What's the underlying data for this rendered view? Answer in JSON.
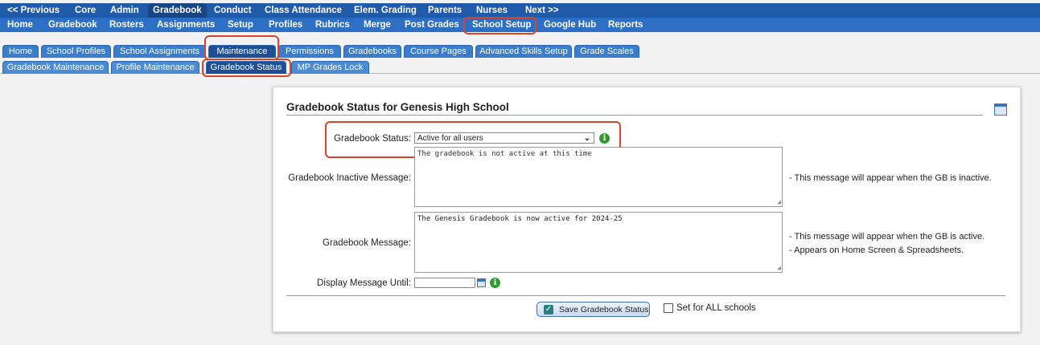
{
  "nav_top": [
    "<< Previous",
    "Core",
    "Admin",
    "Gradebook",
    "Conduct",
    "Class Attendance",
    "Elem. Grading",
    "Parents",
    "Nurses",
    "Next >>"
  ],
  "nav_sub": [
    "Home",
    "Gradebook",
    "Rosters",
    "Assignments",
    "Setup",
    "Profiles",
    "Rubrics",
    "Merge",
    "Post Grades",
    "School Setup",
    "Google Hub",
    "Reports"
  ],
  "tabs1": [
    "Home",
    "School Profiles",
    "School Assignments",
    "Maintenance",
    "Permissions",
    "Gradebooks",
    "Course Pages",
    "Advanced Skills Setup",
    "Grade Scales"
  ],
  "tabs2": [
    "Gradebook Maintenance",
    "Profile Maintenance",
    "Gradebook Status",
    "MP Grades Lock"
  ],
  "panel": {
    "title": "Gradebook Status for Genesis High School",
    "status_label": "Gradebook Status:",
    "status_value": "Active for all users",
    "inactive_label": "Gradebook Inactive Message:",
    "inactive_text": "The gradebook is not active at this time",
    "inactive_note": "- This message will appear when the GB is inactive.",
    "message_label": "Gradebook Message:",
    "message_text": "The Genesis Gradebook is now active for 2024-25",
    "message_note1": "- This message will appear when the GB is active.",
    "message_note2": "- Appears on Home Screen & Spreadsheets.",
    "display_label": "Display Message Until:",
    "save_label": "Save Gradebook Status",
    "all_schools_label": "Set for ALL schools"
  },
  "colors": {
    "nav_dark": "#1f5ba8",
    "nav_light": "#2c6fc4",
    "highlight": "#d9432b",
    "info_green": "#2e9a2e"
  }
}
